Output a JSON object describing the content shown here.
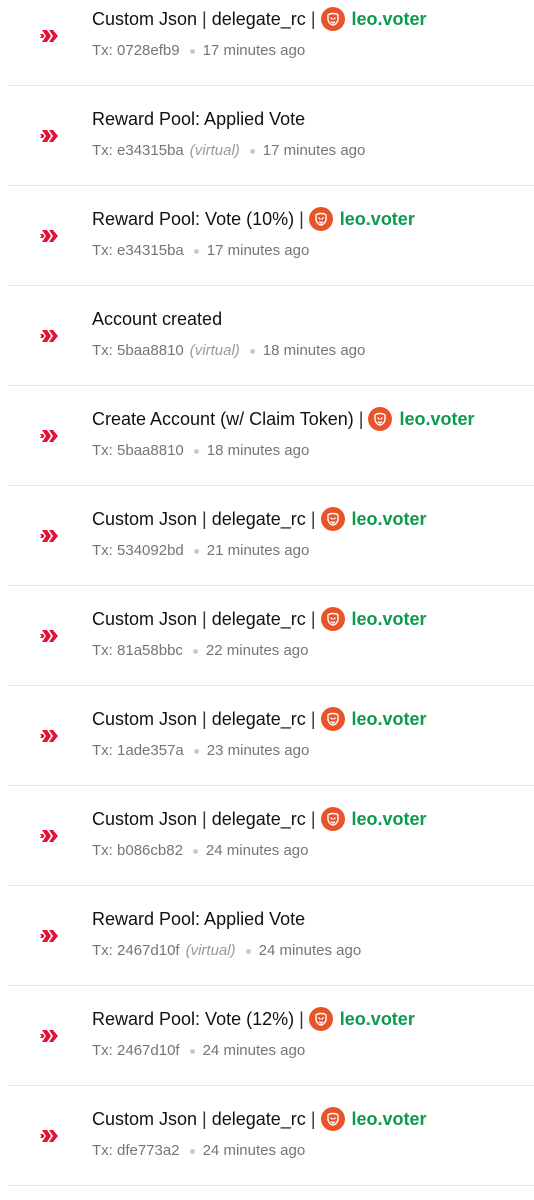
{
  "brand_color": "#e31337",
  "account_color": "#0c9a4d",
  "operations": [
    {
      "parts": [
        "Custom Json",
        "delegate_rc"
      ],
      "account": "leo.voter",
      "tx_label": "Tx:",
      "tx": "0728efb9",
      "virtual": "",
      "time": "17 minutes ago"
    },
    {
      "parts": [
        "Reward Pool: Applied Vote"
      ],
      "account": "",
      "tx_label": "Tx:",
      "tx": "e34315ba",
      "virtual": "(virtual)",
      "time": "17 minutes ago"
    },
    {
      "parts": [
        "Reward Pool: Vote (10%)"
      ],
      "account": "leo.voter",
      "tx_label": "Tx:",
      "tx": "e34315ba",
      "virtual": "",
      "time": "17 minutes ago"
    },
    {
      "parts": [
        "Account created"
      ],
      "account": "",
      "tx_label": "Tx:",
      "tx": "5baa8810",
      "virtual": "(virtual)",
      "time": "18 minutes ago"
    },
    {
      "parts": [
        "Create Account (w/ Claim Token)"
      ],
      "account": "leo.voter",
      "tx_label": "Tx:",
      "tx": "5baa8810",
      "virtual": "",
      "time": "18 minutes ago"
    },
    {
      "parts": [
        "Custom Json",
        "delegate_rc"
      ],
      "account": "leo.voter",
      "tx_label": "Tx:",
      "tx": "534092bd",
      "virtual": "",
      "time": "21 minutes ago"
    },
    {
      "parts": [
        "Custom Json",
        "delegate_rc"
      ],
      "account": "leo.voter",
      "tx_label": "Tx:",
      "tx": "81a58bbc",
      "virtual": "",
      "time": "22 minutes ago"
    },
    {
      "parts": [
        "Custom Json",
        "delegate_rc"
      ],
      "account": "leo.voter",
      "tx_label": "Tx:",
      "tx": "1ade357a",
      "virtual": "",
      "time": "23 minutes ago"
    },
    {
      "parts": [
        "Custom Json",
        "delegate_rc"
      ],
      "account": "leo.voter",
      "tx_label": "Tx:",
      "tx": "b086cb82",
      "virtual": "",
      "time": "24 minutes ago"
    },
    {
      "parts": [
        "Reward Pool: Applied Vote"
      ],
      "account": "",
      "tx_label": "Tx:",
      "tx": "2467d10f",
      "virtual": "(virtual)",
      "time": "24 minutes ago"
    },
    {
      "parts": [
        "Reward Pool: Vote (12%)"
      ],
      "account": "leo.voter",
      "tx_label": "Tx:",
      "tx": "2467d10f",
      "virtual": "",
      "time": "24 minutes ago"
    },
    {
      "parts": [
        "Custom Json",
        "delegate_rc"
      ],
      "account": "leo.voter",
      "tx_label": "Tx:",
      "tx": "dfe773a2",
      "virtual": "",
      "time": "24 minutes ago"
    }
  ]
}
